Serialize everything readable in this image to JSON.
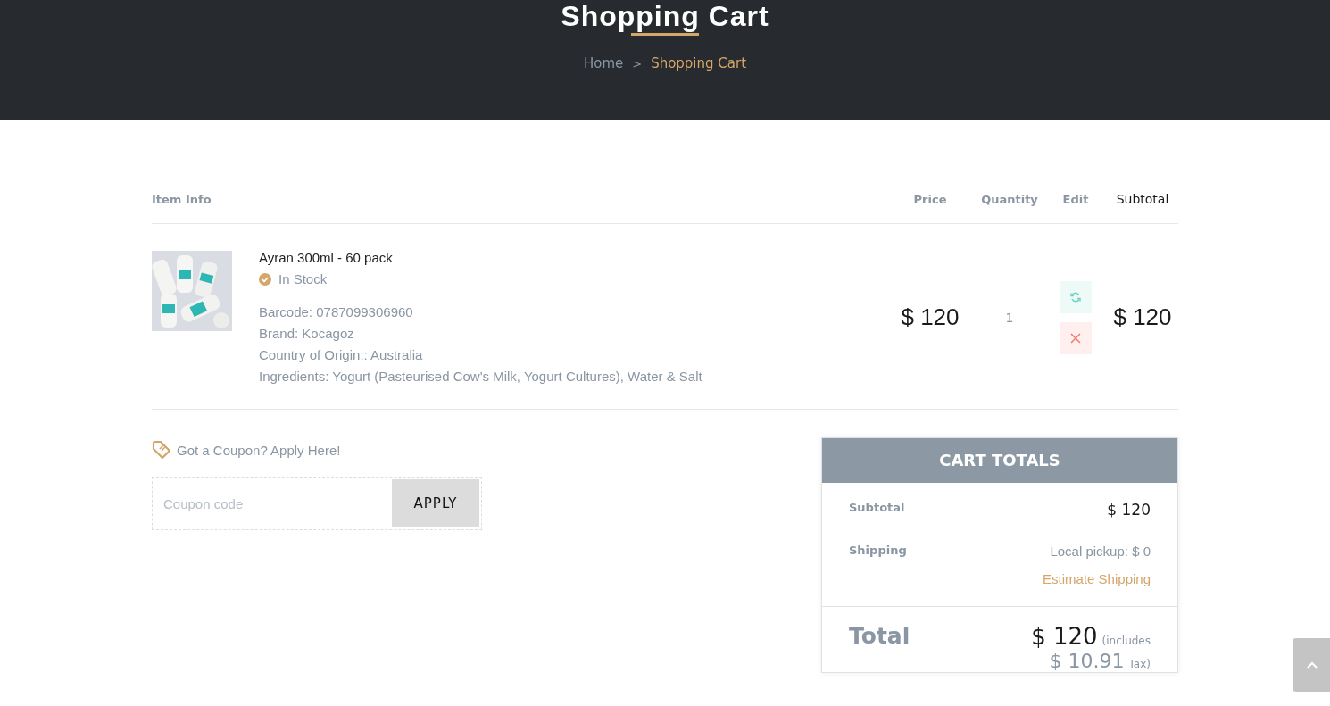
{
  "page_title": "Shopping Cart",
  "breadcrumb": [
    {
      "label": "Home",
      "selected": false
    },
    {
      "label": "Shopping Cart",
      "selected": true
    }
  ],
  "breadcrumb_separator": ">",
  "table": {
    "columns": [
      "Item Info",
      "Price",
      "Quantity",
      "Edit",
      "Subtotal"
    ],
    "rows": [
      {
        "image": {
          "kind": "picture"
        },
        "name": "Ayran 300ml - 60 pack",
        "in_stock": true,
        "stock_label": "In Stock",
        "details": [
          "Barcode: 0787099306960",
          "Brand: Kocagoz",
          "Country of Origin:: Australia",
          "Ingredients: Yogurt (Pasteurised Cow's Milk, Yogurt Cultures), Water & Salt"
        ],
        "price": "$ 120",
        "quantity": "1",
        "subtotal": "$ 120"
      }
    ]
  },
  "coupon": {
    "prompt": "Got a Coupon? Apply Here!",
    "placeholder": "Coupon code",
    "button": "APPLY"
  },
  "cart_totals": {
    "title": "CART TOTALS",
    "subtotal_label": "Subtotal",
    "subtotal": "$ 120",
    "shipping_label": "Shipping",
    "shipping_value": "Local pickup: $ 0",
    "estimate_link": "Estimate Shipping",
    "total_label": "Total",
    "total": "$ 120",
    "tax_open": "(includes",
    "tax_amount": "$ 10.91",
    "tax_close": "Tax)"
  }
}
